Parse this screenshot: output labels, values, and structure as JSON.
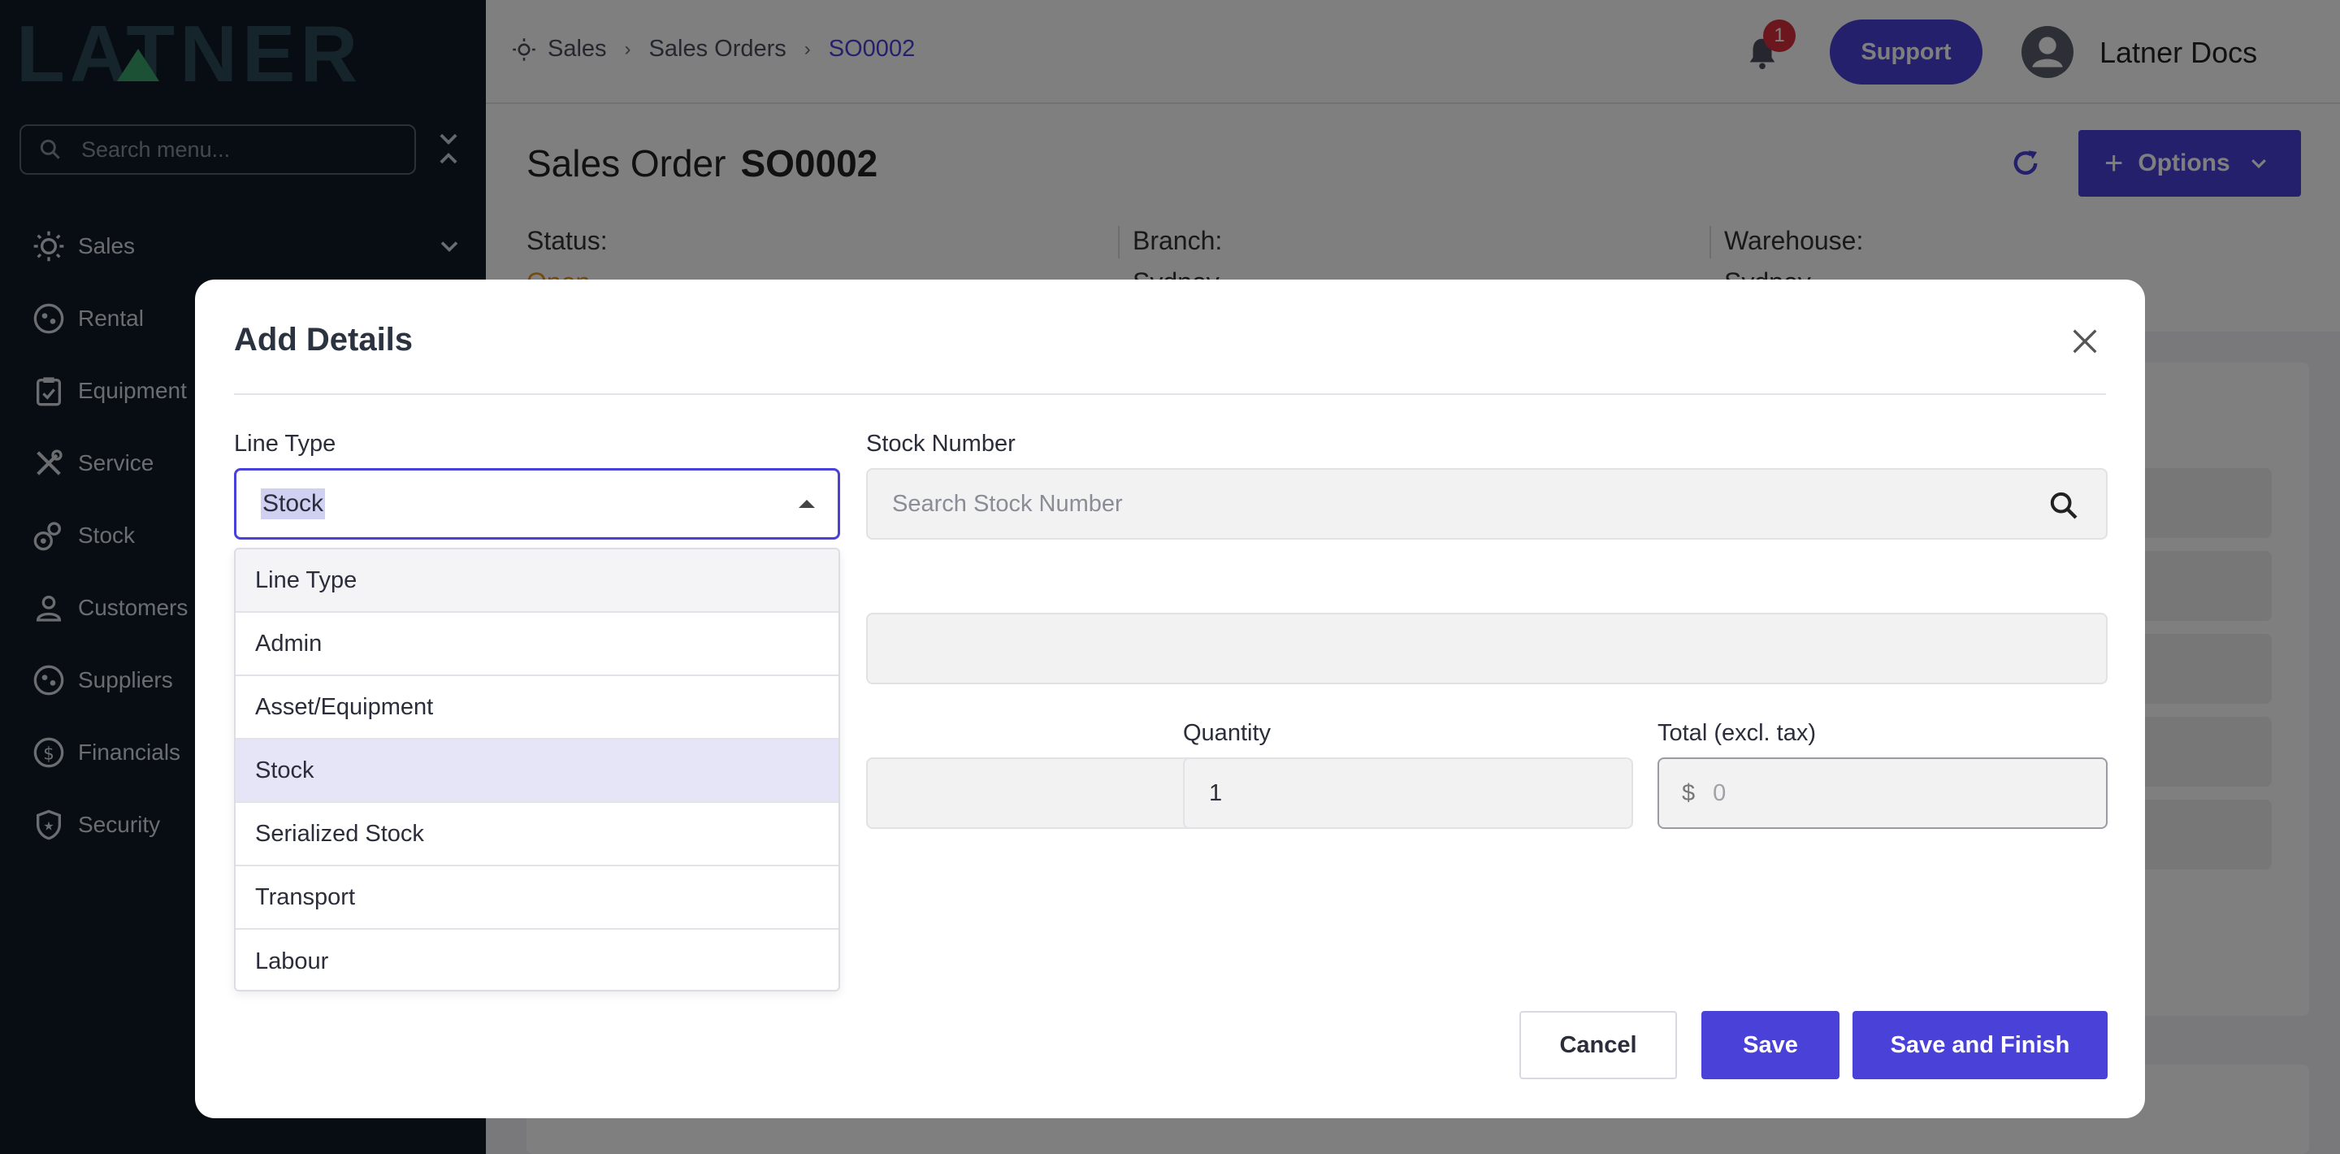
{
  "app": {
    "brand": "LATNER"
  },
  "sidebar": {
    "search_placeholder": "Search menu...",
    "items": [
      {
        "label": "Sales",
        "icon": "sales-icon"
      },
      {
        "label": "Rental",
        "icon": "rental-icon"
      },
      {
        "label": "Equipment",
        "icon": "equipment-icon"
      },
      {
        "label": "Service",
        "icon": "service-icon"
      },
      {
        "label": "Stock",
        "icon": "stock-icon"
      },
      {
        "label": "Customers",
        "icon": "customers-icon"
      },
      {
        "label": "Suppliers",
        "icon": "suppliers-icon"
      },
      {
        "label": "Financials",
        "icon": "financials-icon"
      },
      {
        "label": "Security",
        "icon": "security-icon"
      }
    ]
  },
  "topbar": {
    "breadcrumb": [
      "Sales",
      "Sales Orders",
      "SO0002"
    ],
    "notification_count": "1",
    "support_label": "Support",
    "user_name": "Latner Docs"
  },
  "page": {
    "title": "Sales Order",
    "order_number": "SO0002",
    "options_label": "Options",
    "status_label": "Status:",
    "status_value": "Open",
    "branch_label": "Branch:",
    "branch_value": "Sydney",
    "warehouse_label": "Warehouse:",
    "warehouse_value": "Sydney"
  },
  "modal": {
    "title": "Add Details",
    "line_type_label": "Line Type",
    "line_type_value": "Stock",
    "stock_number_label": "Stock Number",
    "stock_number_placeholder": "Search Stock Number",
    "quantity_label": "Quantity",
    "quantity_value": "1",
    "total_label": "Total (excl. tax)",
    "total_currency": "$",
    "total_placeholder": "0",
    "dropdown_options": [
      "Line Type",
      "Admin",
      "Asset/Equipment",
      "Stock",
      "Serialized Stock",
      "Transport",
      "Labour"
    ],
    "selected_option": "Stock",
    "cancel_label": "Cancel",
    "save_label": "Save",
    "save_finish_label": "Save and Finish"
  },
  "colors": {
    "accent": "#4a41d8",
    "sidebar_bg": "#0f1a24",
    "status_open": "#e8951a",
    "badge": "#d92d3a"
  }
}
